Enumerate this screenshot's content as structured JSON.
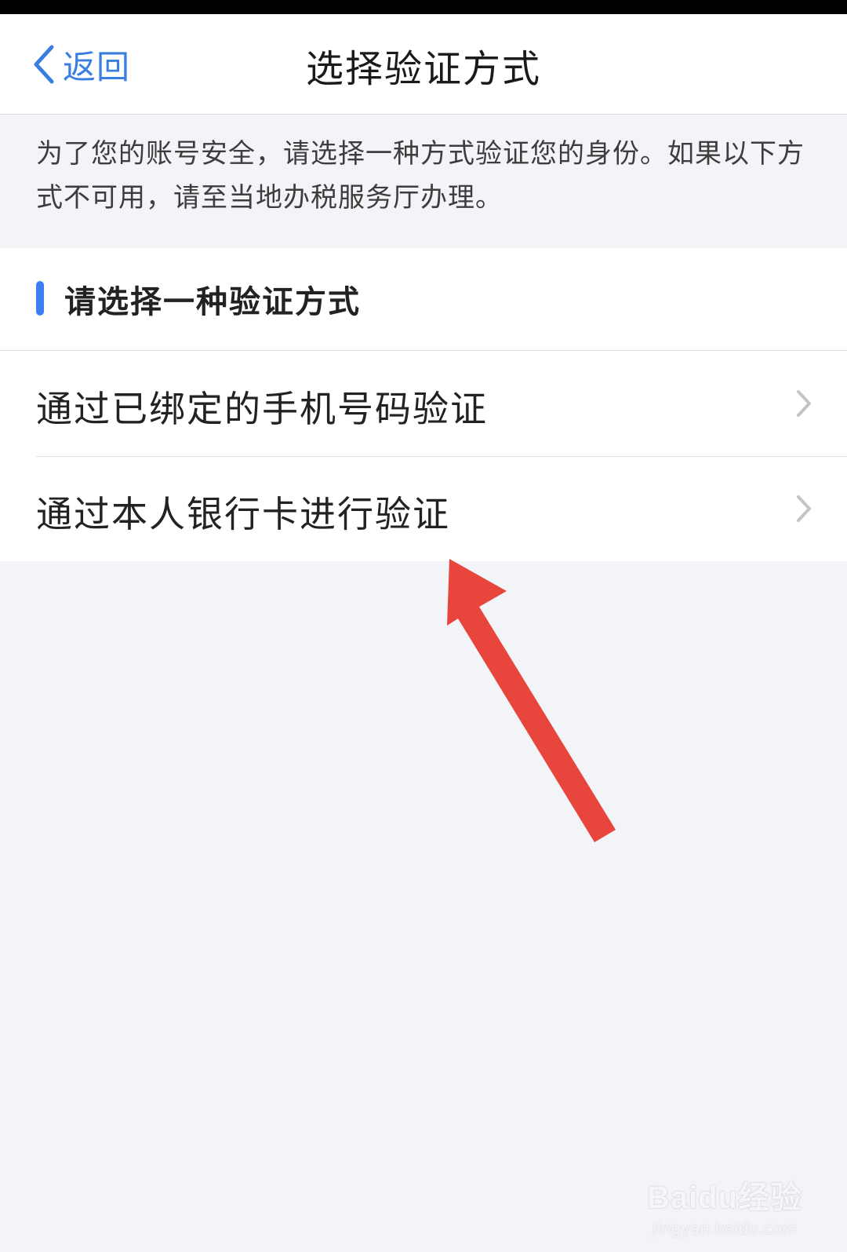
{
  "nav": {
    "back_label": "返回",
    "title": "选择验证方式"
  },
  "notice": {
    "text": "为了您的账号安全，请选择一种方式验证您的身份。如果以下方式不可用，请至当地办税服务厅办理。"
  },
  "section": {
    "title": "请选择一种验证方式",
    "options": [
      {
        "label": "通过已绑定的手机号码验证",
        "icon": "chevron-right-icon"
      },
      {
        "label": "通过本人银行卡进行验证",
        "icon": "chevron-right-icon"
      }
    ]
  },
  "annotation": {
    "icon": "red-arrow",
    "color": "#e8453c"
  },
  "watermark": {
    "logo": "Baidu经验",
    "url": "jingyan.baidu.com"
  },
  "colors": {
    "accent": "#3a7fe0",
    "section_marker": "#3b7ff2",
    "background": "#f3f4f8",
    "card": "#ffffff"
  }
}
